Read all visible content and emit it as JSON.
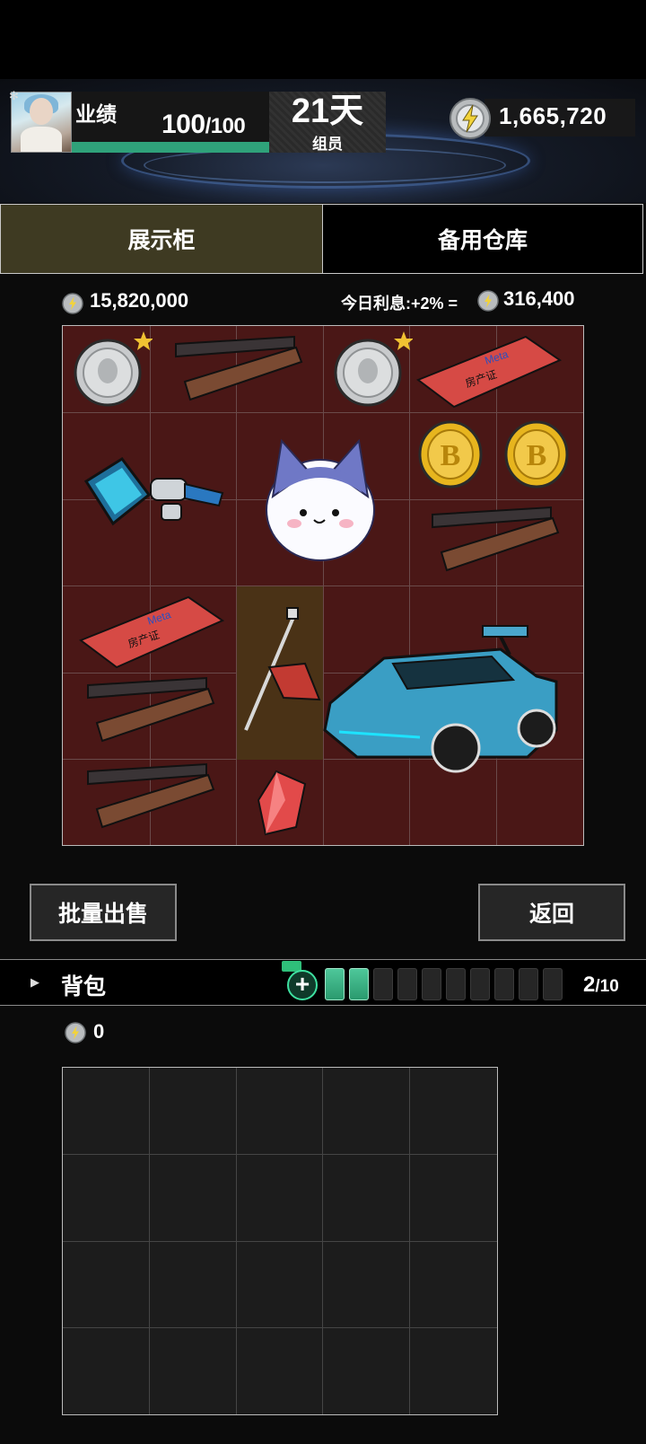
{
  "header": {
    "performance_label": "业绩",
    "performance_current": "100",
    "performance_max": "/100",
    "performance_progress": 1.0,
    "days": "21天",
    "role": "组员",
    "money": "1,665,720",
    "icons": {
      "settings": "gear-icon",
      "currency": "lightning-coin-icon"
    }
  },
  "tabs": [
    {
      "label": "展示柜",
      "active": true
    },
    {
      "label": "备用仓库",
      "active": false
    }
  ],
  "showcase": {
    "total_value": "15,820,000",
    "interest_label": "今日利息:+2% =",
    "interest_value": "316,400",
    "items": [
      {
        "name": "silver-coin",
        "starred": true
      },
      {
        "name": "wooden-chopsticks-box"
      },
      {
        "name": "silver-coin",
        "starred": true
      },
      {
        "name": "meta-property-card",
        "brand": "Meta",
        "text": "房产证"
      },
      {
        "name": "robot-drone"
      },
      {
        "name": "cat-plush"
      },
      {
        "name": "bitcoin-coin"
      },
      {
        "name": "bitcoin-coin"
      },
      {
        "name": "wooden-chopsticks-box"
      },
      {
        "name": "meta-property-card",
        "brand": "Meta",
        "text": "房产证"
      },
      {
        "name": "red-tool-hammer"
      },
      {
        "name": "blue-sports-car"
      },
      {
        "name": "wooden-chopsticks-box"
      },
      {
        "name": "wooden-chopsticks-box"
      },
      {
        "name": "red-crystal-gem"
      }
    ]
  },
  "buttons": {
    "batch_sell": "批量出售",
    "back": "返回"
  },
  "backpack": {
    "title": "背包",
    "slots_used": "2",
    "slots_total": "/10",
    "money": "0"
  },
  "colors": {
    "showcase_bg": "#4a1716",
    "active_tab": "#3e3a22",
    "progress_green": "#2fa27a",
    "battery_green": "#3ee0a0"
  }
}
